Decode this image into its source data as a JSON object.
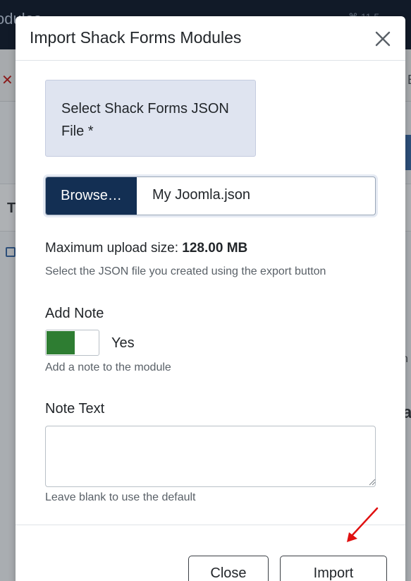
{
  "background": {
    "title_fragment": "odules",
    "corner_fragment": "⌘ 11.5",
    "right_letter": "E",
    "panel_letter": "T",
    "right_n": "n",
    "right_a": "a"
  },
  "modal": {
    "title": "Import Shack Forms Modules",
    "file_field": {
      "label": "Select Shack Forms JSON File *",
      "browse_label": "Browse…",
      "file_name": "My Joomla.json",
      "max_upload_prefix": "Maximum upload size: ",
      "max_upload_value": "128.00 MB",
      "help": "Select the JSON file you created using the export button"
    },
    "add_note": {
      "label": "Add Note",
      "state_label": "Yes",
      "help": "Add a note to the module"
    },
    "note_text": {
      "label": "Note Text",
      "value": "",
      "help": "Leave blank to use the default"
    },
    "footer": {
      "close_label": "Close",
      "import_label": "Import"
    }
  },
  "colors": {
    "browse_bg": "#132f53",
    "toggle_on": "#2e7d32",
    "annotation_arrow": "#e01010"
  }
}
